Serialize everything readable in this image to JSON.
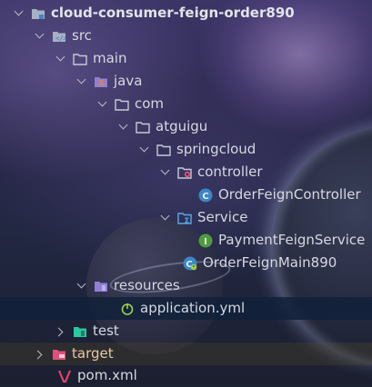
{
  "tree": [
    {
      "label": "cloud-consumer-feign-order890",
      "icon": "module-folder-icon"
    },
    {
      "label": "src",
      "icon": "source-folder-icon"
    },
    {
      "label": "main",
      "icon": "folder-icon"
    },
    {
      "label": "java",
      "icon": "java-source-folder-icon"
    },
    {
      "label": "com",
      "icon": "package-icon"
    },
    {
      "label": "atguigu",
      "icon": "package-icon"
    },
    {
      "label": "springcloud",
      "icon": "package-icon"
    },
    {
      "label": "controller",
      "icon": "controller-package-icon"
    },
    {
      "label": "OrderFeignController",
      "icon": "class-icon"
    },
    {
      "label": "Service",
      "icon": "service-package-icon"
    },
    {
      "label": "PaymentFeignService",
      "icon": "interface-icon"
    },
    {
      "label": "OrderFeignMain890",
      "icon": "spring-boot-main-class-icon"
    },
    {
      "label": "resources",
      "icon": "resources-folder-icon"
    },
    {
      "label": "application.yml",
      "icon": "spring-config-file-icon"
    },
    {
      "label": "test",
      "icon": "test-folder-icon"
    },
    {
      "label": "target",
      "icon": "excluded-folder-icon"
    },
    {
      "label": "pom.xml",
      "icon": "maven-icon"
    }
  ],
  "colors": {
    "selected_row": "#10213a",
    "folder": "#a7b1c2",
    "class_badge": "#3b86c8",
    "interface_badge": "#4f9c3e",
    "spring_green": "#9bd24a",
    "test_folder": "#2dc7a0",
    "target_folder": "#e0507a",
    "maven": "#e2436a"
  }
}
